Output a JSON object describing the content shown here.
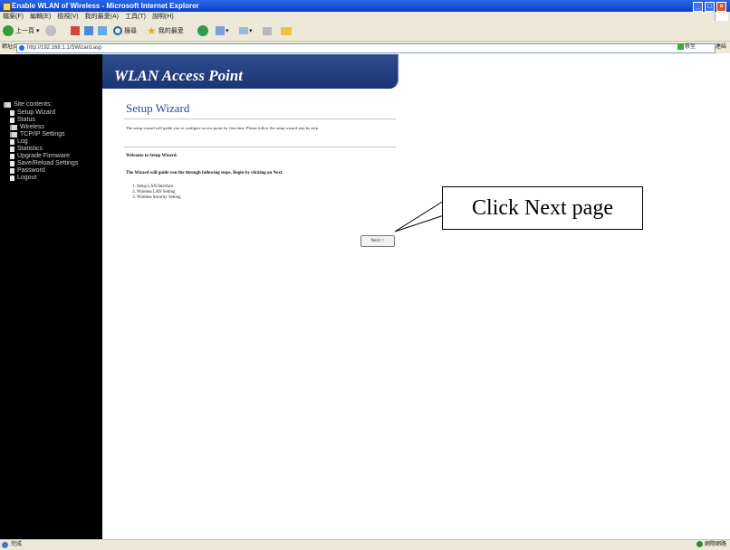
{
  "window": {
    "title": "Enable WLAN of Wireless - Microsoft Internet Explorer",
    "controls": [
      "_",
      "□",
      "×"
    ]
  },
  "menubar": {
    "items": [
      "檔案(F)",
      "編輯(E)",
      "檢視(V)",
      "我的最愛(A)",
      "工具(T)",
      "說明(H)"
    ]
  },
  "toolbar": {
    "back_label": "上一頁",
    "search_label": "搜尋",
    "favorites_label": "我的最愛"
  },
  "addressbar": {
    "label": "網址(D)",
    "url": "http://192.168.1.1/SWizard.asp",
    "go_label": "移至",
    "links_label": "連結"
  },
  "banner": {
    "title": "WLAN Access Point"
  },
  "sidebar": {
    "root_label": "Site contents:",
    "items": [
      "Setup Wizard",
      "Status",
      "Wireless",
      "TCP/IP Settings",
      "Log",
      "Statistics",
      "Upgrade Firmware",
      "Save/Reload Settings",
      "Password",
      "Logout"
    ]
  },
  "main": {
    "title": "Setup Wizard",
    "intro": "The setup wizard will guide you to configure access point for first time. Please follow the setup wizard step by step.",
    "welcome": "Welcome to Setup Wizard.",
    "guide": "The Wizard will guide you the through following steps. Begin by clicking on Next.",
    "steps": [
      "Setup LAN Interface",
      "Wireless LAN Setting",
      "Wireless Security Setting"
    ],
    "next_button": "Next>>"
  },
  "annotation": {
    "text": "Click Next page"
  },
  "statusbar": {
    "text": "完成",
    "zone": "網際網路"
  }
}
